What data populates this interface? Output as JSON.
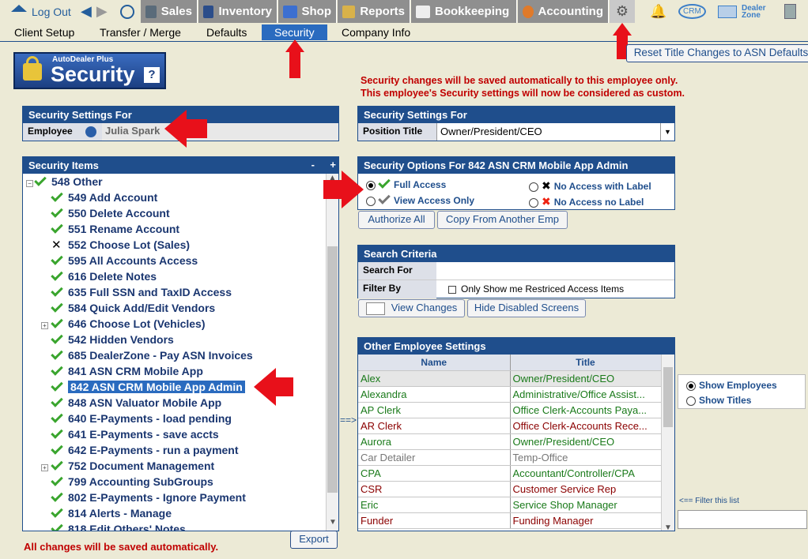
{
  "nav": {
    "logout": "Log Out",
    "tabs": [
      "Sales",
      "Inventory",
      "Shop",
      "Reports",
      "Bookkeeping",
      "Accounting"
    ],
    "crm": "CRM",
    "dealer_zone_1": "Dealer",
    "dealer_zone_2": "Zone"
  },
  "subnav": [
    "Client Setup",
    "Transfer / Merge",
    "Defaults",
    "Security",
    "Company Info"
  ],
  "reset_button": "Reset Title Changes to ASN Defaults",
  "logo": {
    "small": "AutoDealer Plus",
    "big": "Security",
    "help": "?"
  },
  "notice_1": "Security changes will be saved automatically to this employee only.",
  "notice_2": "This employee's Security settings will now be considered as custom.",
  "left": {
    "header": "Security Settings For",
    "employee_label": "Employee",
    "employee_value": "Julia Spark",
    "items_header": "Security Items",
    "minus": "-",
    "plus": "+"
  },
  "tree": [
    {
      "code": "548",
      "name": "Other",
      "mark": "check",
      "indent": 0,
      "expander": "-"
    },
    {
      "code": "549",
      "name": "Add Account",
      "mark": "check",
      "indent": 1
    },
    {
      "code": "550",
      "name": "Delete Account",
      "mark": "check",
      "indent": 1
    },
    {
      "code": "551",
      "name": "Rename Account",
      "mark": "check",
      "indent": 1
    },
    {
      "code": "552",
      "name": "Choose Lot (Sales)",
      "mark": "x",
      "indent": 1
    },
    {
      "code": "595",
      "name": "All Accounts Access",
      "mark": "check",
      "indent": 1
    },
    {
      "code": "616",
      "name": "Delete Notes",
      "mark": "check",
      "indent": 1
    },
    {
      "code": "635",
      "name": "Full SSN and TaxID Access",
      "mark": "check",
      "indent": 1
    },
    {
      "code": "584",
      "name": "Quick Add/Edit Vendors",
      "mark": "check",
      "indent": 1
    },
    {
      "code": "646",
      "name": "Choose Lot (Vehicles)",
      "mark": "check",
      "indent": 1,
      "expander": "+"
    },
    {
      "code": "542",
      "name": "Hidden Vendors",
      "mark": "check",
      "indent": 1
    },
    {
      "code": "685",
      "name": "DealerZone - Pay ASN Invoices",
      "mark": "check",
      "indent": 1
    },
    {
      "code": "841",
      "name": "ASN CRM Mobile App",
      "mark": "check",
      "indent": 1
    },
    {
      "code": "842",
      "name": "ASN CRM Mobile App Admin",
      "mark": "check",
      "indent": 1,
      "selected": true
    },
    {
      "code": "848",
      "name": "ASN Valuator Mobile App",
      "mark": "check",
      "indent": 1
    },
    {
      "code": "640",
      "name": "E-Payments - load pending",
      "mark": "check",
      "indent": 1
    },
    {
      "code": "641",
      "name": "E-Payments - save accts",
      "mark": "check",
      "indent": 1
    },
    {
      "code": "642",
      "name": "E-Payments - run a payment",
      "mark": "check",
      "indent": 1
    },
    {
      "code": "752",
      "name": "Document Management",
      "mark": "check",
      "indent": 1,
      "expander": "+"
    },
    {
      "code": "799",
      "name": "Accounting SubGroups",
      "mark": "check",
      "indent": 1
    },
    {
      "code": "802",
      "name": "E-Payments - Ignore Payment",
      "mark": "check",
      "indent": 1
    },
    {
      "code": "814",
      "name": "Alerts - Manage",
      "mark": "check",
      "indent": 1
    },
    {
      "code": "818",
      "name": "Edit Others' Notes",
      "mark": "check",
      "indent": 1
    }
  ],
  "footer_note": "All changes will be saved automatically.",
  "export_button": "Export",
  "right": {
    "header": "Security Settings For",
    "position_label": "Position Title",
    "position_value": "Owner/President/CEO",
    "options_header": "Security Options For 842  ASN CRM Mobile App Admin",
    "opt_full": "Full Access",
    "opt_view": "View Access Only",
    "opt_nolabel": "No Access with Label",
    "opt_nolabel2": "No Access no Label",
    "authorize": "Authorize All",
    "copy": "Copy From Another Emp",
    "search_header": "Search Criteria",
    "search_for": "Search For",
    "filter_by": "Filter By",
    "filter_check": "Only Show me Restriced Access Items",
    "view_changes": "View Changes",
    "hide_disabled": "Hide Disabled Screens",
    "other_header": "Other Employee Settings",
    "col_name": "Name",
    "col_title": "Title",
    "arrow_text": "==>"
  },
  "employees": [
    {
      "name": "Alex",
      "title": "Owner/President/CEO",
      "color": "#1a7a1a"
    },
    {
      "name": "Alexandra",
      "title": "Administrative/Office Assist...",
      "color": "#1a7a1a"
    },
    {
      "name": "AP Clerk",
      "title": "Office Clerk-Accounts Paya...",
      "color": "#1a7a1a"
    },
    {
      "name": "AR Clerk",
      "title": "Office Clerk-Accounts Rece...",
      "color": "#8b0000"
    },
    {
      "name": "Aurora",
      "title": "Owner/President/CEO",
      "color": "#1a7a1a"
    },
    {
      "name": "Car Detailer",
      "title": "Temp-Office",
      "color": "#777777"
    },
    {
      "name": "CPA",
      "title": "Accountant/Controller/CPA",
      "color": "#1a7a1a"
    },
    {
      "name": "CSR",
      "title": "Customer Service Rep",
      "color": "#8b0000"
    },
    {
      "name": "Eric",
      "title": "Service Shop Manager",
      "color": "#1a7a1a"
    },
    {
      "name": "Funder",
      "title": "Funding Manager",
      "color": "#8b0000"
    }
  ],
  "show": {
    "employees": "Show Employees",
    "titles": "Show Titles",
    "filter_hint": "<== Filter this list"
  }
}
